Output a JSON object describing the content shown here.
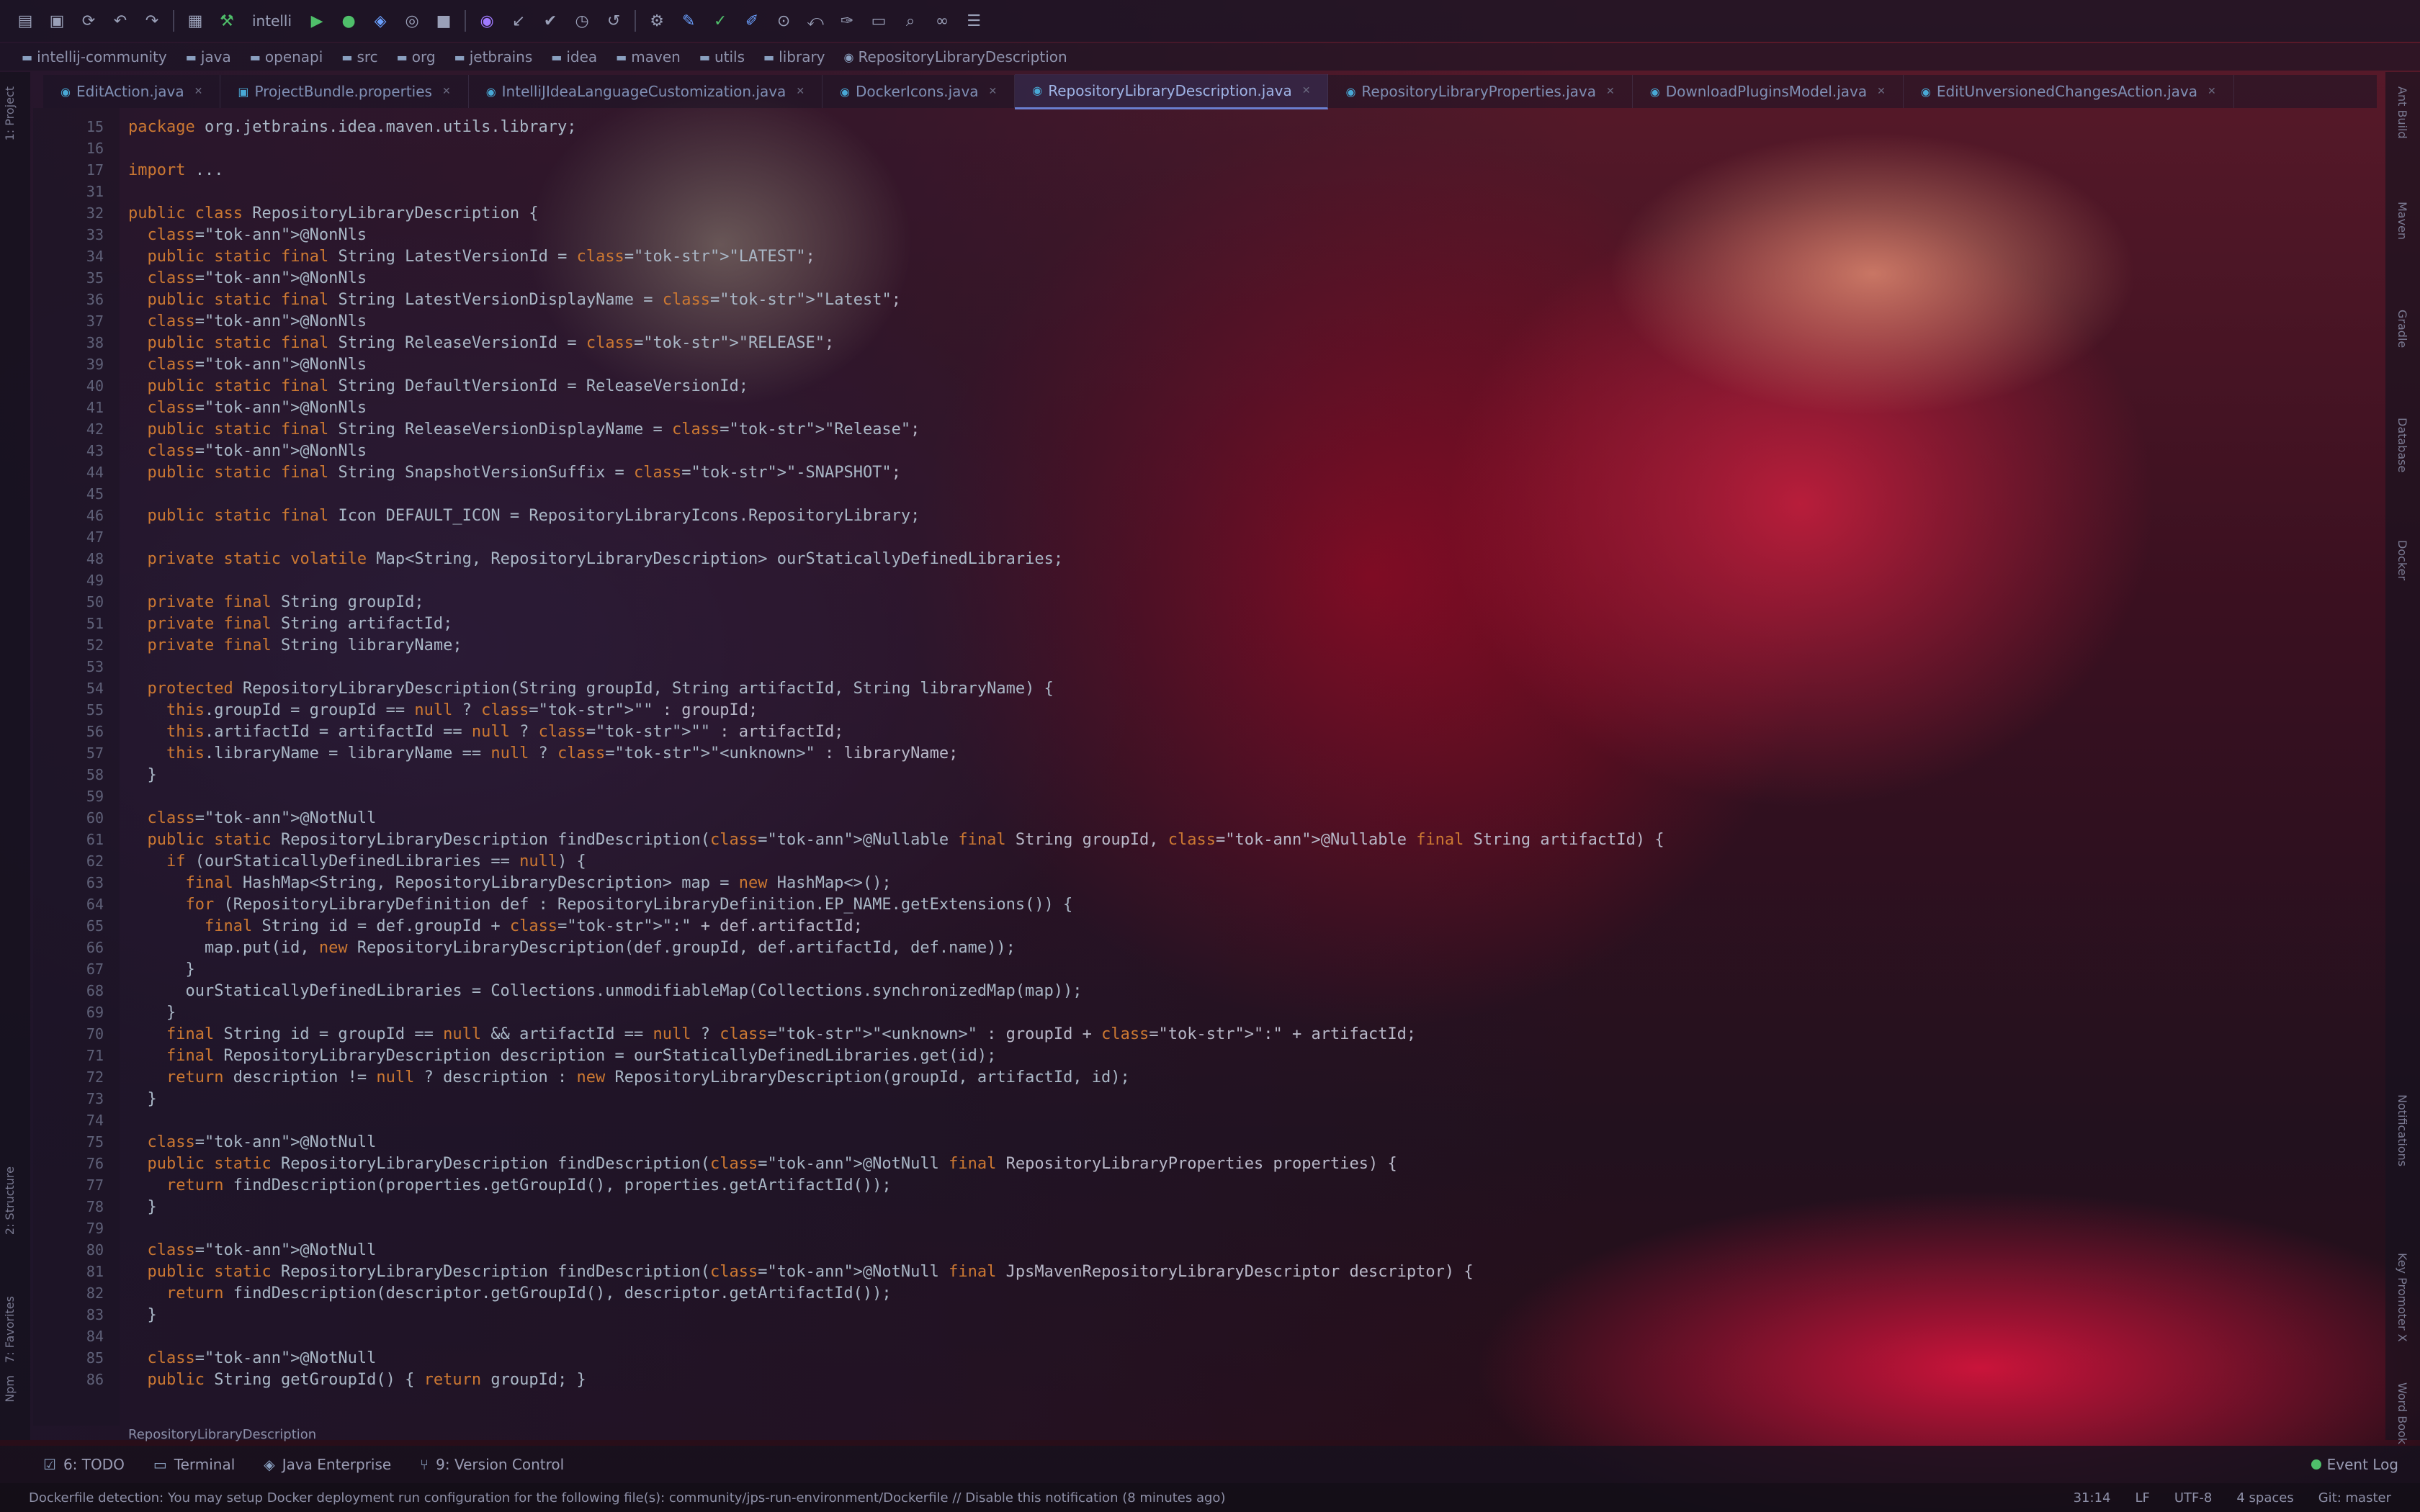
{
  "toolbar": {
    "icons": [
      "open-icon",
      "save-icon",
      "sync-icon",
      "undo-icon",
      "redo-icon",
      "project-structure-icon",
      "build-icon"
    ],
    "run_config": "intelli"
  },
  "breadcrumbs": [
    "intellij-community",
    "java",
    "openapi",
    "src",
    "org",
    "jetbrains",
    "idea",
    "maven",
    "utils",
    "library",
    "RepositoryLibraryDescription"
  ],
  "tabs": [
    {
      "label": "EditAction.java",
      "active": false
    },
    {
      "label": "ProjectBundle.properties",
      "active": false
    },
    {
      "label": "IntelliJIdeaLanguageCustomization.java",
      "active": false
    },
    {
      "label": "DockerIcons.java",
      "active": false
    },
    {
      "label": "RepositoryLibraryDescription.java",
      "active": true
    },
    {
      "label": "RepositoryLibraryProperties.java",
      "active": false
    },
    {
      "label": "DownloadPluginsModel.java",
      "active": false
    },
    {
      "label": "EditUnversionedChangesAction.java",
      "active": false
    }
  ],
  "left_tools": [
    "1: Project",
    "2: Structure",
    "7: Favorites",
    "Npm"
  ],
  "right_tools": [
    "Ant Build",
    "Maven",
    "Gradle",
    "Database",
    "Docker",
    "Notifications",
    "Key Promoter X",
    "Word Book"
  ],
  "code_lines": [
    {
      "n": "15",
      "t": "package org.jetbrains.idea.maven.utils.library;"
    },
    {
      "n": "16",
      "t": ""
    },
    {
      "n": "17",
      "t": "import ..."
    },
    {
      "n": "31",
      "t": ""
    },
    {
      "n": "32",
      "t": "public class RepositoryLibraryDescription {"
    },
    {
      "n": "33",
      "t": "  @NonNls"
    },
    {
      "n": "34",
      "t": "  public static final String LatestVersionId = \"LATEST\";"
    },
    {
      "n": "35",
      "t": "  @NonNls"
    },
    {
      "n": "36",
      "t": "  public static final String LatestVersionDisplayName = \"Latest\";"
    },
    {
      "n": "37",
      "t": "  @NonNls"
    },
    {
      "n": "38",
      "t": "  public static final String ReleaseVersionId = \"RELEASE\";"
    },
    {
      "n": "39",
      "t": "  @NonNls"
    },
    {
      "n": "40",
      "t": "  public static final String DefaultVersionId = ReleaseVersionId;"
    },
    {
      "n": "41",
      "t": "  @NonNls"
    },
    {
      "n": "42",
      "t": "  public static final String ReleaseVersionDisplayName = \"Release\";"
    },
    {
      "n": "43",
      "t": "  @NonNls"
    },
    {
      "n": "44",
      "t": "  public static final String SnapshotVersionSuffix = \"-SNAPSHOT\";"
    },
    {
      "n": "45",
      "t": ""
    },
    {
      "n": "46",
      "t": "  public static final Icon DEFAULT_ICON = RepositoryLibraryIcons.RepositoryLibrary;"
    },
    {
      "n": "47",
      "t": ""
    },
    {
      "n": "48",
      "t": "  private static volatile Map<String, RepositoryLibraryDescription> ourStaticallyDefinedLibraries;"
    },
    {
      "n": "49",
      "t": ""
    },
    {
      "n": "50",
      "t": "  private final String groupId;"
    },
    {
      "n": "51",
      "t": "  private final String artifactId;"
    },
    {
      "n": "52",
      "t": "  private final String libraryName;"
    },
    {
      "n": "53",
      "t": ""
    },
    {
      "n": "54",
      "t": "  protected RepositoryLibraryDescription(String groupId, String artifactId, String libraryName) {"
    },
    {
      "n": "55",
      "t": "    this.groupId = groupId == null ? \"\" : groupId;"
    },
    {
      "n": "56",
      "t": "    this.artifactId = artifactId == null ? \"\" : artifactId;"
    },
    {
      "n": "57",
      "t": "    this.libraryName = libraryName == null ? \"<unknown>\" : libraryName;"
    },
    {
      "n": "58",
      "t": "  }"
    },
    {
      "n": "59",
      "t": ""
    },
    {
      "n": "60",
      "t": "  @NotNull"
    },
    {
      "n": "61",
      "t": "  public static RepositoryLibraryDescription findDescription(@Nullable final String groupId, @Nullable final String artifactId) {"
    },
    {
      "n": "62",
      "t": "    if (ourStaticallyDefinedLibraries == null) {"
    },
    {
      "n": "63",
      "t": "      final HashMap<String, RepositoryLibraryDescription> map = new HashMap<>();"
    },
    {
      "n": "64",
      "t": "      for (RepositoryLibraryDefinition def : RepositoryLibraryDefinition.EP_NAME.getExtensions()) {"
    },
    {
      "n": "65",
      "t": "        final String id = def.groupId + \":\" + def.artifactId;"
    },
    {
      "n": "66",
      "t": "        map.put(id, new RepositoryLibraryDescription(def.groupId, def.artifactId, def.name));"
    },
    {
      "n": "67",
      "t": "      }"
    },
    {
      "n": "68",
      "t": "      ourStaticallyDefinedLibraries = Collections.unmodifiableMap(Collections.synchronizedMap(map));"
    },
    {
      "n": "69",
      "t": "    }"
    },
    {
      "n": "70",
      "t": "    final String id = groupId == null && artifactId == null ? \"<unknown>\" : groupId + \":\" + artifactId;"
    },
    {
      "n": "71",
      "t": "    final RepositoryLibraryDescription description = ourStaticallyDefinedLibraries.get(id);"
    },
    {
      "n": "72",
      "t": "    return description != null ? description : new RepositoryLibraryDescription(groupId, artifactId, id);"
    },
    {
      "n": "73",
      "t": "  }"
    },
    {
      "n": "74",
      "t": ""
    },
    {
      "n": "75",
      "t": "  @NotNull"
    },
    {
      "n": "76",
      "t": "  public static RepositoryLibraryDescription findDescription(@NotNull final RepositoryLibraryProperties properties) {"
    },
    {
      "n": "77",
      "t": "    return findDescription(properties.getGroupId(), properties.getArtifactId());"
    },
    {
      "n": "78",
      "t": "  }"
    },
    {
      "n": "79",
      "t": ""
    },
    {
      "n": "80",
      "t": "  @NotNull"
    },
    {
      "n": "81",
      "t": "  public static RepositoryLibraryDescription findDescription(@NotNull final JpsMavenRepositoryLibraryDescriptor descriptor) {"
    },
    {
      "n": "82",
      "t": "    return findDescription(descriptor.getGroupId(), descriptor.getArtifactId());"
    },
    {
      "n": "83",
      "t": "  }"
    },
    {
      "n": "84",
      "t": ""
    },
    {
      "n": "85",
      "t": "  @NotNull"
    },
    {
      "n": "86",
      "t": "  public String getGroupId() { return groupId; }"
    }
  ],
  "fold_breadcrumb": "RepositoryLibraryDescription",
  "bottom_tools": [
    {
      "label": "6: TODO",
      "icon": "todo-icon"
    },
    {
      "label": "Terminal",
      "icon": "terminal-icon"
    },
    {
      "label": "Java Enterprise",
      "icon": "java-enterprise-icon"
    },
    {
      "label": "9: Version Control",
      "icon": "vcs-icon"
    }
  ],
  "event_log": "Event Log",
  "status": {
    "message": "Dockerfile detection: You may setup Docker deployment run configuration for the following file(s): community/jps-run-environment/Dockerfile // Disable this notification (8 minutes ago)",
    "position": "31:14",
    "line_sep": "LF",
    "encoding": "UTF-8",
    "indent": "4 spaces",
    "vcs": "Git: master"
  },
  "colors": {
    "accent": "#6a7fd0",
    "keyword": "#cc7832",
    "string": "#6a8759",
    "field": "#9876aa",
    "method": "#ffc66d"
  }
}
